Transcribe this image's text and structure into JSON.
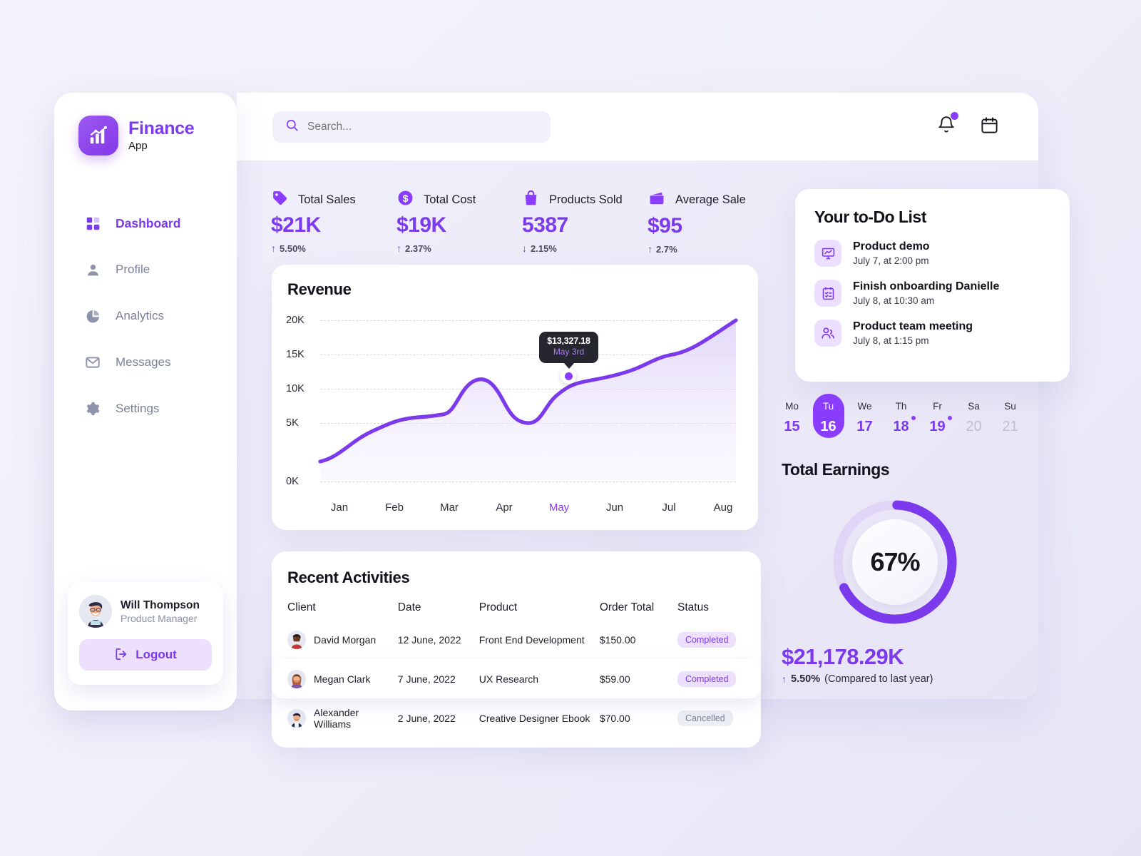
{
  "brand": {
    "name": "Finance",
    "sub": "App",
    "logo_icon": "bar-chart-logo-icon"
  },
  "sidebar": {
    "items": [
      {
        "label": "Dashboard",
        "icon": "grid-icon",
        "active": true
      },
      {
        "label": "Profile",
        "icon": "user-icon",
        "active": false
      },
      {
        "label": "Analytics",
        "icon": "pie-chart-icon",
        "active": false
      },
      {
        "label": "Messages",
        "icon": "envelope-icon",
        "active": false
      },
      {
        "label": "Settings",
        "icon": "gear-icon",
        "active": false
      }
    ],
    "user": {
      "name": "Will Thompson",
      "role": "Product Manager",
      "avatar": "user-avatar"
    },
    "logout_label": "Logout",
    "logout_icon": "logout-icon"
  },
  "topbar": {
    "search_placeholder": "Search...",
    "search_value": "",
    "search_icon": "search-icon",
    "notifications_icon": "bell-icon",
    "has_notification": true,
    "calendar_icon": "calendar-icon"
  },
  "stats": [
    {
      "label": "Total Sales",
      "value": "$21K",
      "delta": "5.50%",
      "dir": "up",
      "icon": "tag-icon"
    },
    {
      "label": "Total Cost",
      "value": "$19K",
      "delta": "2.37%",
      "dir": "up",
      "icon": "dollar-coin-icon"
    },
    {
      "label": "Products Sold",
      "value": "5387",
      "delta": "2.15%",
      "dir": "down",
      "icon": "shopping-bag-icon"
    },
    {
      "label": "Average Sale",
      "value": "$95",
      "delta": "2.7%",
      "dir": "up",
      "icon": "wallet-icon"
    }
  ],
  "revenue": {
    "title": "Revenue",
    "tooltip": {
      "value": "$13,327.18",
      "date": "May 3rd"
    }
  },
  "chart_data": {
    "type": "area",
    "title": "Revenue",
    "xlabel": "",
    "ylabel": "",
    "x": [
      "Jan",
      "Feb",
      "Mar",
      "Apr",
      "May",
      "Jun",
      "Jul",
      "Aug"
    ],
    "categories": [
      "Jan",
      "Feb",
      "Mar",
      "Apr",
      "May",
      "Jun",
      "Jul",
      "Aug"
    ],
    "values": [
      2900,
      6400,
      11000,
      8200,
      13327,
      14400,
      17200,
      20100
    ],
    "series": [
      {
        "name": "Revenue",
        "values": [
          2900,
          6400,
          11000,
          8200,
          13327,
          14400,
          17200,
          20100
        ]
      }
    ],
    "ylim": [
      0,
      20000
    ],
    "ytick_labels": [
      "0K",
      "5K",
      "10K",
      "15K",
      "20K"
    ],
    "ytick_values": [
      0,
      5000,
      10000,
      15000,
      20000
    ],
    "grid": true,
    "legend": false,
    "highlight_x": "May",
    "annotation": {
      "value": "$13,327.18",
      "date": "May 3rd"
    },
    "line_color": "#7c3aed",
    "fill_color": "#ede8fb"
  },
  "activities": {
    "title": "Recent Activities",
    "columns": [
      "Client",
      "Date",
      "Product",
      "Order Total",
      "Status"
    ],
    "rows": [
      {
        "client": "David Morgan",
        "date": "12 June, 2022",
        "product": "Front End Development",
        "total": "$150.00",
        "status": "Completed",
        "highlighted": false,
        "avatar": "client-avatar"
      },
      {
        "client": "Megan Clark",
        "date": "7 June, 2022",
        "product": "UX Research",
        "total": "$59.00",
        "status": "Completed",
        "highlighted": true,
        "avatar": "client-avatar"
      },
      {
        "client": "Alexander Williams",
        "date": "2 June, 2022",
        "product": "Creative Designer Ebook",
        "total": "$70.00",
        "status": "Cancelled",
        "highlighted": false,
        "avatar": "client-avatar"
      }
    ]
  },
  "todo": {
    "title": "Your to-Do List",
    "items": [
      {
        "title": "Product demo",
        "subtitle": "July 7, at 2:00 pm",
        "icon": "presentation-chart-icon"
      },
      {
        "title": "Finish onboarding Danielle",
        "subtitle": "July 8, at 10:30 am",
        "icon": "clipboard-check-icon"
      },
      {
        "title": "Product team meeting",
        "subtitle": "July 8, at 1:15 pm",
        "icon": "people-icon"
      }
    ]
  },
  "calendar": {
    "days": [
      {
        "dow": "Mo",
        "num": "15",
        "selected": false,
        "muted": false,
        "dot": false
      },
      {
        "dow": "Tu",
        "num": "16",
        "selected": true,
        "muted": false,
        "dot": false
      },
      {
        "dow": "We",
        "num": "17",
        "selected": false,
        "muted": false,
        "dot": false
      },
      {
        "dow": "Th",
        "num": "18",
        "selected": false,
        "muted": false,
        "dot": true
      },
      {
        "dow": "Fr",
        "num": "19",
        "selected": false,
        "muted": false,
        "dot": true
      },
      {
        "dow": "Sa",
        "num": "20",
        "selected": false,
        "muted": true,
        "dot": false
      },
      {
        "dow": "Su",
        "num": "21",
        "selected": false,
        "muted": true,
        "dot": false
      }
    ]
  },
  "earnings": {
    "title": "Total Earnings",
    "percent_label": "67%",
    "percent": 67,
    "value": "$21,178.29K",
    "delta": "5.50%",
    "delta_note": "(Compared to last year)",
    "dir": "up"
  },
  "colors": {
    "accent": "#7c3aed",
    "accent_bright": "#8b3dff",
    "accent_soft": "#ece0fd",
    "page_bg": "#f1f0fb",
    "text": "#12121c",
    "muted": "#7b8199",
    "tooltip_bg": "#26262e"
  }
}
